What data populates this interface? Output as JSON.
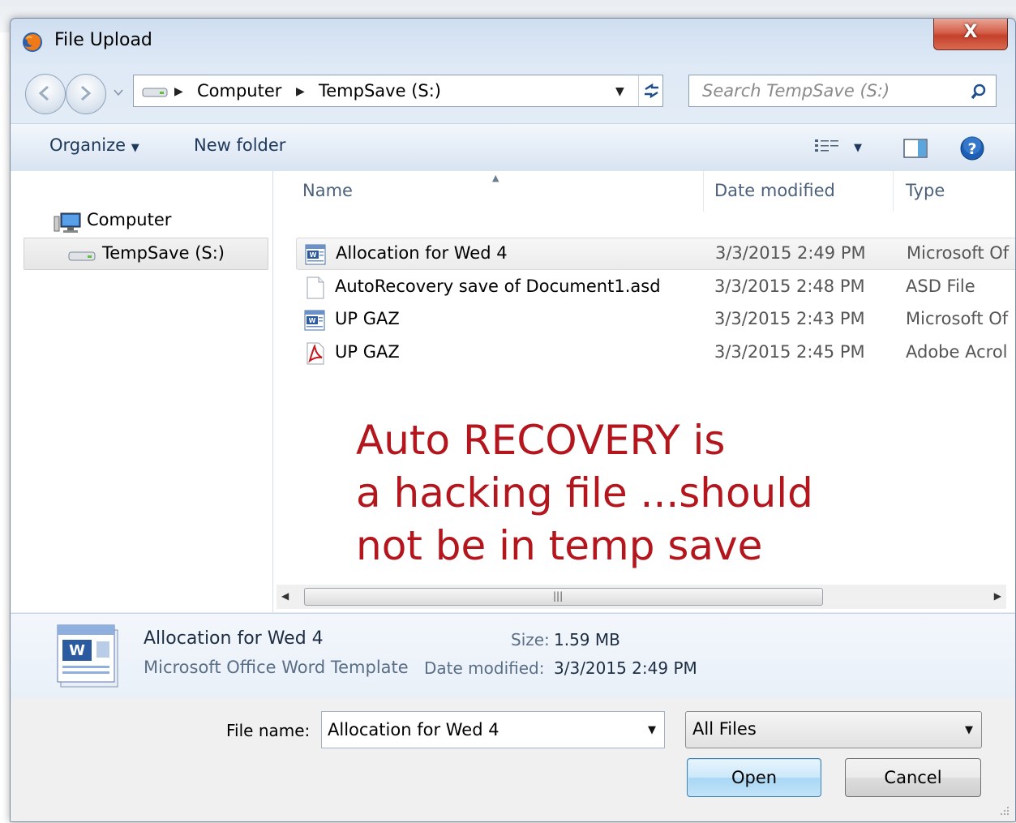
{
  "window": {
    "title": "File Upload",
    "close_label": "X"
  },
  "address_bar": {
    "crumbs": [
      "Computer",
      "TempSave (S:)"
    ]
  },
  "search": {
    "placeholder": "Search TempSave (S:)"
  },
  "toolbar": {
    "organize_label": "Organize",
    "new_folder_label": "New folder"
  },
  "nav_pane": {
    "items": [
      {
        "label": "Computer"
      },
      {
        "label": "TempSave (S:)"
      }
    ]
  },
  "file_list": {
    "columns": [
      "Name",
      "Date modified",
      "Type"
    ],
    "rows": [
      {
        "name": "Allocation for Wed 4",
        "date": "3/3/2015 2:49 PM",
        "type": "Microsoft Of",
        "icon": "word-template-icon"
      },
      {
        "name": "AutoRecovery save of Document1.asd",
        "date": "3/3/2015 2:48 PM",
        "type": "ASD File",
        "icon": "blank-file-icon"
      },
      {
        "name": "UP GAZ",
        "date": "3/3/2015 2:43 PM",
        "type": "Microsoft Of",
        "icon": "word-template-icon"
      },
      {
        "name": "UP GAZ",
        "date": "3/3/2015 2:45 PM",
        "type": "Adobe Acrol",
        "icon": "pdf-file-icon"
      }
    ]
  },
  "annotation": {
    "lines": [
      "Auto RECOVERY is",
      "a hacking file ...should",
      "not be in temp save"
    ],
    "color": "#b4161d"
  },
  "details": {
    "name": "Allocation for Wed 4",
    "type": "Microsoft Office Word Template",
    "size_label": "Size:",
    "size": "1.59 MB",
    "date_label": "Date modified:",
    "date": "3/3/2015 2:49 PM"
  },
  "bottom": {
    "file_name_label": "File name:",
    "file_name_value": "Allocation for Wed 4",
    "file_type_value": "All Files",
    "open_label": "Open",
    "cancel_label": "Cancel"
  }
}
